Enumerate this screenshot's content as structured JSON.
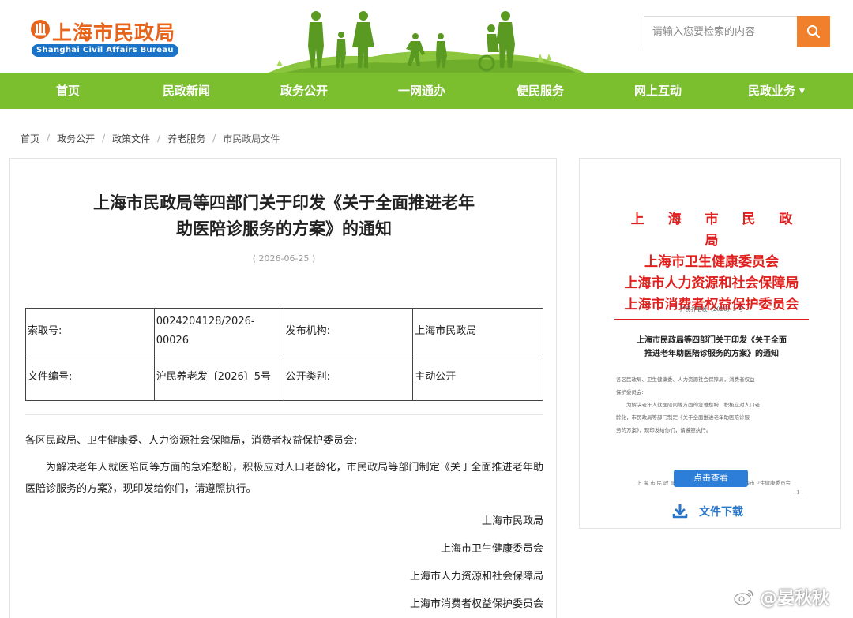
{
  "header": {
    "logo_cn": "上海市民政局",
    "logo_en": "Shanghai Civil Affairs Bureau",
    "search_placeholder": "请输入您要检索的内容",
    "brand_orange": "#f0802c",
    "brand_green": "#7cbf2e"
  },
  "nav": {
    "items": [
      {
        "label": "首页"
      },
      {
        "label": "民政新闻"
      },
      {
        "label": "政务公开"
      },
      {
        "label": "一网通办"
      },
      {
        "label": "便民服务"
      },
      {
        "label": "网上互动"
      },
      {
        "label": "民政业务",
        "dropdown": true
      }
    ]
  },
  "breadcrumb": [
    "首页",
    "政务公开",
    "政策文件",
    "养老服务",
    "市民政局文件"
  ],
  "article": {
    "title_line1": "上海市民政局等四部门关于印发《关于全面推进老年",
    "title_line2": "助医陪诊服务的方案》的通知",
    "date": "( 2026-06-25 )",
    "meta": {
      "index_label": "索取号:",
      "index_value": "0024204128/2026-00026",
      "org_label": "发布机构:",
      "org_value": "上海市民政局",
      "docno_label": "文件编号:",
      "docno_value": "沪民养老发〔2026〕5号",
      "category_label": "公开类别:",
      "category_value": "主动公开"
    },
    "salutation": "各区民政局、卫生健康委、人力资源社会保障局，消费者权益保护委员会:",
    "paragraph": "为解决老年人就医陪同等方面的急难愁盼，积极应对人口老龄化，市民政局等部门制定《关于全面推进老年助医陪诊服务的方案》，现印发给你们，请遵照执行。",
    "signatures": [
      "上海市民政局",
      "上海市卫生健康委员会",
      "上海市人力资源和社会保障局",
      "上海市消费者权益保护委员会"
    ]
  },
  "side": {
    "issuers": [
      "上 海 市 民 政 局",
      "上海市卫生健康委员会",
      "上海市人力资源和社会保障局",
      "上海市消费者权益保护委员会"
    ],
    "doc_number": "沪民养老发〔2026〕5 号",
    "doc_title_line1": "上海市民政局等四部门关于印发《关于全面",
    "doc_title_line2": "推进老年助医陪诊服务的方案》的通知",
    "doc_line1": "各区民政局、卫生健康委、人力资源社会保障局，消费者权益",
    "doc_line2": "保护委员会:",
    "doc_line3": "为解决老年人就医陪同等方面的急难愁盼，积极应对人口老",
    "doc_line4": "龄化，市民政局等部门制定《关于全面推进老年助医陪诊服",
    "doc_line5": "务的方案》，现印发给你们，请遵照执行。",
    "doc_foot_left": "上海市民政局",
    "doc_foot_right": "上海市卫生健康委员会",
    "doc_page": "- 1 -",
    "view_button": "点击查看",
    "download_label": "文件下载",
    "red": "#e0201e",
    "blue": "#2d7ed8"
  },
  "watermark": "@晏秋秋"
}
